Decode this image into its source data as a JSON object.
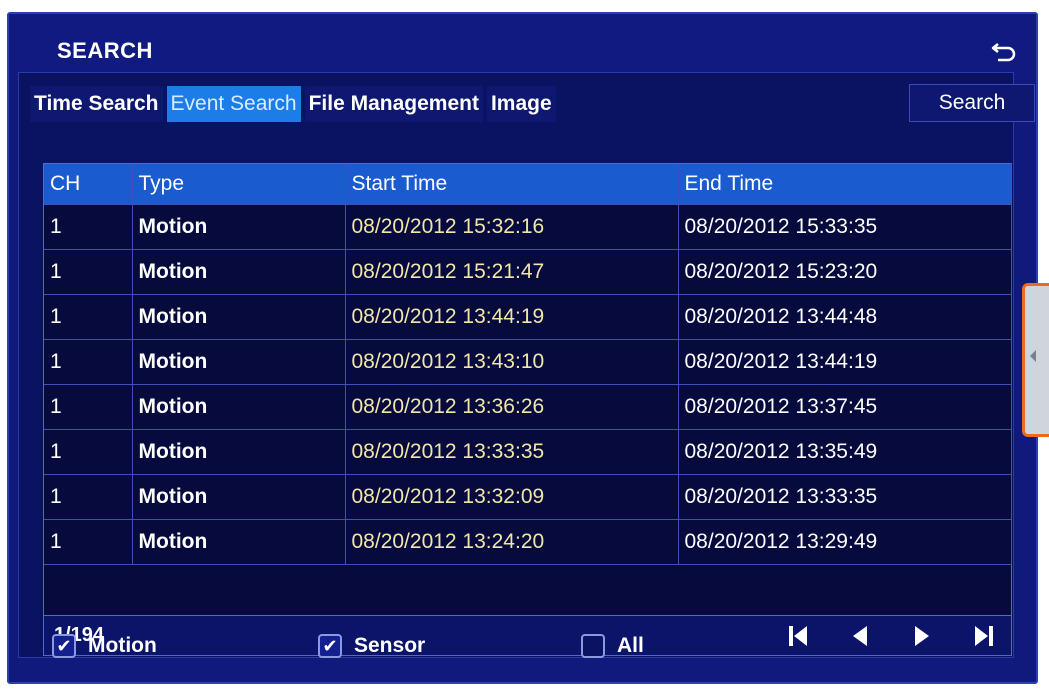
{
  "window": {
    "title": "SEARCH"
  },
  "tabs": [
    {
      "label": "Time Search"
    },
    {
      "label": "Event Search",
      "active": true
    },
    {
      "label": "File Management"
    },
    {
      "label": "Image"
    }
  ],
  "search_button_label": "Search",
  "table": {
    "headers": {
      "ch": "CH",
      "type": "Type",
      "start": "Start Time",
      "end": "End Time"
    },
    "rows": [
      {
        "ch": "1",
        "type": "Motion",
        "start": "08/20/2012 15:32:16",
        "end": "08/20/2012 15:33:35"
      },
      {
        "ch": "1",
        "type": "Motion",
        "start": "08/20/2012 15:21:47",
        "end": "08/20/2012 15:23:20"
      },
      {
        "ch": "1",
        "type": "Motion",
        "start": "08/20/2012 13:44:19",
        "end": "08/20/2012 13:44:48"
      },
      {
        "ch": "1",
        "type": "Motion",
        "start": "08/20/2012 13:43:10",
        "end": "08/20/2012 13:44:19"
      },
      {
        "ch": "1",
        "type": "Motion",
        "start": "08/20/2012 13:36:26",
        "end": "08/20/2012 13:37:45"
      },
      {
        "ch": "1",
        "type": "Motion",
        "start": "08/20/2012 13:33:35",
        "end": "08/20/2012 13:35:49"
      },
      {
        "ch": "1",
        "type": "Motion",
        "start": "08/20/2012 13:32:09",
        "end": "08/20/2012 13:33:35"
      },
      {
        "ch": "1",
        "type": "Motion",
        "start": "08/20/2012 13:24:20",
        "end": "08/20/2012 13:29:49"
      }
    ]
  },
  "pagination": {
    "indicator": "1/194"
  },
  "filters": {
    "motion": {
      "label": "Motion",
      "checked": true
    },
    "sensor": {
      "label": "Sensor",
      "checked": true
    },
    "all": {
      "label": "All",
      "checked": false
    }
  },
  "icons": {
    "back": "back-arrow-icon",
    "first": "first-page-icon",
    "prev": "prev-page-icon",
    "next": "next-page-icon",
    "last": "last-page-icon",
    "check": "checkmark-icon",
    "side_handle": "side-panel-handle-icon"
  },
  "colors": {
    "background": "#0f1a7c",
    "active_tab": "#1d7de8",
    "header_row": "#1a5cd0",
    "start_time_text": "#f0e6a8",
    "highlight_border": "#ec6b1c"
  }
}
